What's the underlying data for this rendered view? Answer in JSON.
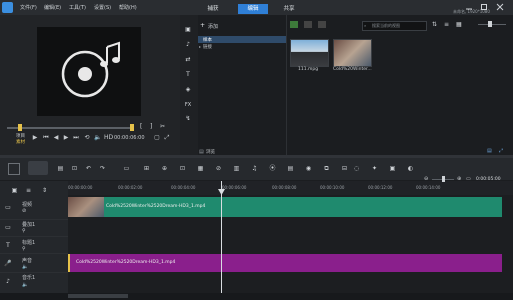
{
  "menu": {
    "items": [
      "文件(F)",
      "编辑(E)",
      "工具(T)",
      "设置(S)",
      "帮助(H)"
    ]
  },
  "mode_tabs": {
    "capture": "捕获",
    "edit": "编辑",
    "share": "共享"
  },
  "project_info": "未命名, 1920*1080",
  "player": {
    "project_label": "项目",
    "clip_label": "素材",
    "timecode": "00:00:06:00",
    "zoom_hint": "▾"
  },
  "library": {
    "add_label": "添加",
    "tree": [
      "样本",
      "链接"
    ],
    "search_placeholder": "搜索当前的视图",
    "browse_label": "浏览",
    "thumbnails": [
      {
        "label": "111.mpg"
      },
      {
        "label": "Cold%20Winter..."
      }
    ]
  },
  "timeline": {
    "timecode": "0:00:05:00",
    "ruler_ticks": [
      "00:00:00:00",
      "00:00:02:00",
      "00:00:04:00",
      "00:00:06:00",
      "00:00:08:00",
      "00:00:10:00",
      "00:00:12:00",
      "00:00:14:00"
    ],
    "tracks": [
      {
        "name": "视频"
      },
      {
        "name": "叠加1"
      },
      {
        "name": "标题1"
      },
      {
        "name": "声音"
      },
      {
        "name": "音乐1"
      }
    ],
    "video_clip_name": "Cold%2520Winter%2520Dream-HD3_1.mp4",
    "audio_clip_name": "Cold%2520Winter%2520Dream-HD3_1.mp4"
  },
  "colors": {
    "accent": "#2f7fd6",
    "video_clip": "#1f8a6e",
    "audio_clip": "#8a1f8c"
  }
}
